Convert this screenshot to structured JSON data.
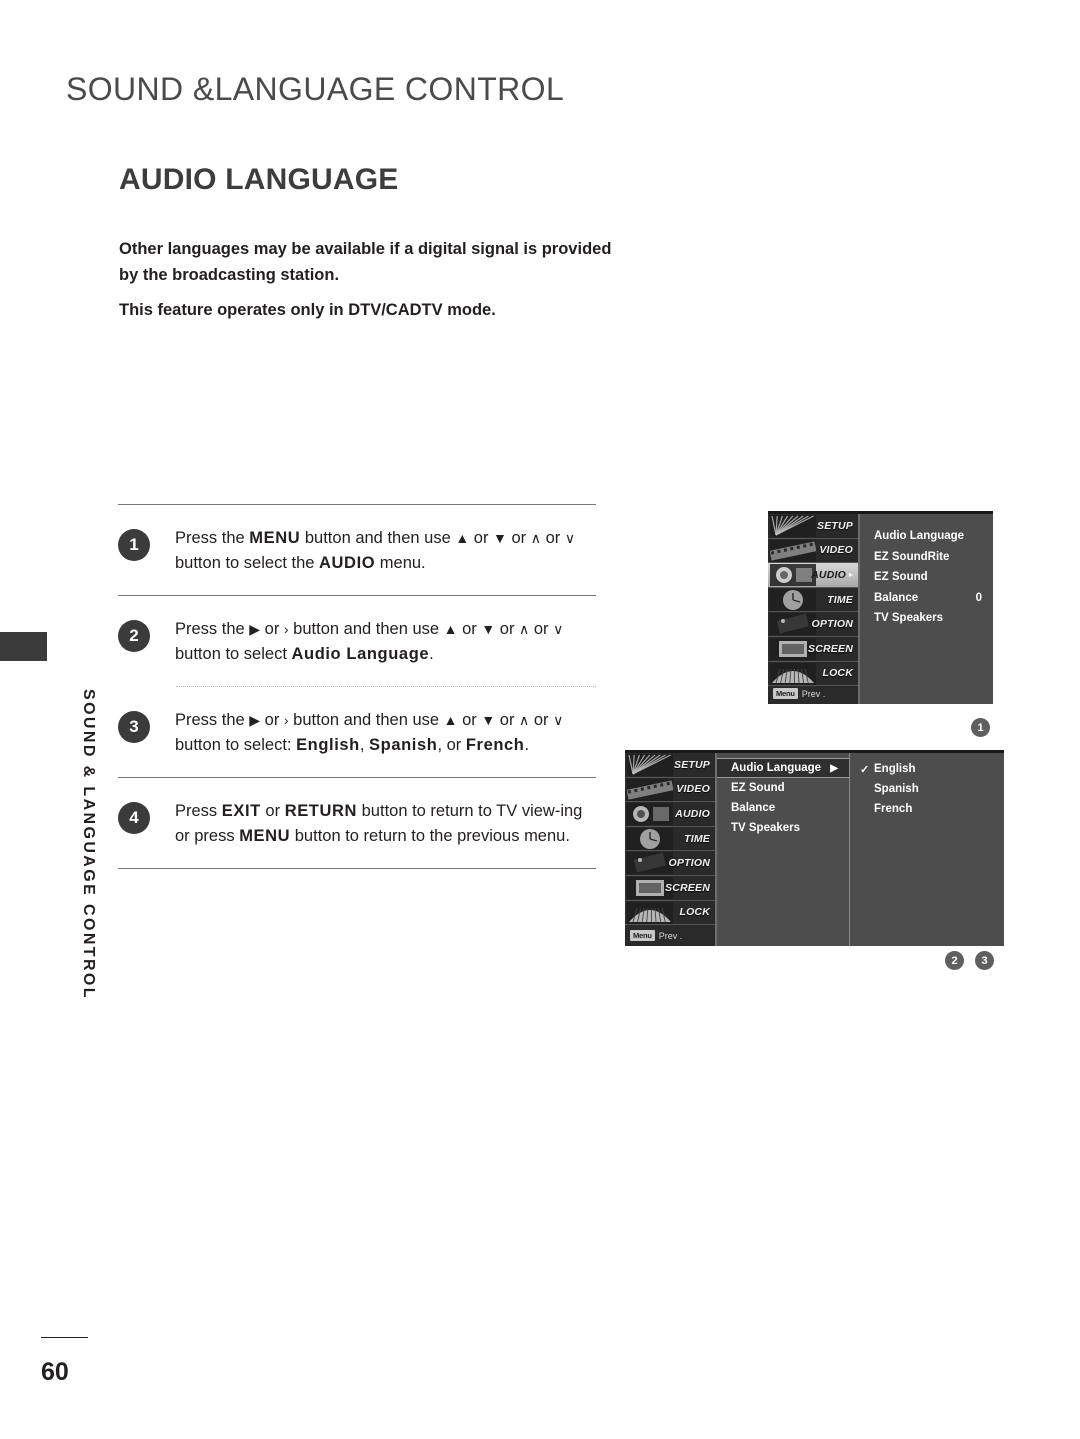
{
  "page": {
    "chapter_title": "SOUND &LANGUAGE CONTROL",
    "section_title": "AUDIO LANGUAGE",
    "page_number": "60",
    "side_tab_label": "SOUND & LANGUAGE CONTROL"
  },
  "intro": {
    "line1": "Other languages may be available if a digital signal is provided by the broadcasting station.",
    "line2": "This feature operates only in DTV/CADTV mode."
  },
  "steps": [
    {
      "number": "1",
      "parts": [
        {
          "t": "Press the ",
          "b": false
        },
        {
          "t": "MENU",
          "b": true
        },
        {
          "t": " button and then use ",
          "b": false
        },
        {
          "t": "▲",
          "b": false
        },
        {
          "t": " or ",
          "b": false
        },
        {
          "t": "▼",
          "b": false
        },
        {
          "t": "  or  ",
          "b": false
        },
        {
          "t": "∧",
          "b": false
        },
        {
          "t": " or ",
          "b": false
        },
        {
          "t": "∨",
          "b": false
        },
        {
          "t": "  button to select the ",
          "b": false
        },
        {
          "t": "AUDIO",
          "b": true
        },
        {
          "t": " menu.",
          "b": false
        }
      ]
    },
    {
      "number": "2",
      "parts": [
        {
          "t": "Press the ",
          "b": false
        },
        {
          "t": "▶",
          "b": false
        },
        {
          "t": " or ",
          "b": false
        },
        {
          "t": "›",
          "b": false
        },
        {
          "t": "  button and then use ",
          "b": false
        },
        {
          "t": "▲",
          "b": false
        },
        {
          "t": " or ",
          "b": false
        },
        {
          "t": "▼",
          "b": false
        },
        {
          "t": "  or  ",
          "b": false
        },
        {
          "t": "∧",
          "b": false
        },
        {
          "t": " or ",
          "b": false
        },
        {
          "t": "∨",
          "b": false
        },
        {
          "t": "  button to select ",
          "b": false
        },
        {
          "t": "Audio Language",
          "b": true
        },
        {
          "t": ".",
          "b": false
        }
      ]
    },
    {
      "number": "3",
      "parts": [
        {
          "t": "Press the ",
          "b": false
        },
        {
          "t": "▶",
          "b": false
        },
        {
          "t": " or ",
          "b": false
        },
        {
          "t": "›",
          "b": false
        },
        {
          "t": "  button and then use ",
          "b": false
        },
        {
          "t": "▲",
          "b": false
        },
        {
          "t": " or ",
          "b": false
        },
        {
          "t": "▼",
          "b": false
        },
        {
          "t": "  or  ",
          "b": false
        },
        {
          "t": "∧",
          "b": false
        },
        {
          "t": " or ",
          "b": false
        },
        {
          "t": "∨",
          "b": false
        },
        {
          "t": "  button to select: ",
          "b": false
        },
        {
          "t": "English",
          "b": true
        },
        {
          "t": ", ",
          "b": false
        },
        {
          "t": "Spanish",
          "b": true
        },
        {
          "t": ", or ",
          "b": false
        },
        {
          "t": "French",
          "b": true
        },
        {
          "t": ".",
          "b": false
        }
      ]
    },
    {
      "number": "4",
      "parts": [
        {
          "t": "Press ",
          "b": false
        },
        {
          "t": "EXIT",
          "b": true
        },
        {
          "t": " or ",
          "b": false
        },
        {
          "t": "RETURN",
          "b": true
        },
        {
          "t": " button to return to TV view-ing or press ",
          "b": false
        },
        {
          "t": "MENU",
          "b": true
        },
        {
          "t": " button to return to the previous menu.",
          "b": false
        }
      ]
    }
  ],
  "osd_screens": [
    {
      "marker": "1",
      "sidebar": [
        {
          "label": "SETUP",
          "icon": "fan-icon",
          "selected": false,
          "caret": ""
        },
        {
          "label": "VIDEO",
          "icon": "filmstrip-icon",
          "selected": false,
          "caret": ""
        },
        {
          "label": "AUDIO",
          "icon": "speaker-dial-icon",
          "selected": true,
          "caret": "▸"
        },
        {
          "label": "TIME",
          "icon": "clock-icon",
          "selected": false,
          "caret": ""
        },
        {
          "label": "OPTION",
          "icon": "tag-icon",
          "selected": false,
          "caret": ""
        },
        {
          "label": "SCREEN",
          "icon": "monitor-icon",
          "selected": false,
          "caret": ""
        },
        {
          "label": "LOCK",
          "icon": "lock-icon",
          "selected": false,
          "caret": ""
        }
      ],
      "prev_key": "Menu",
      "prev_label": "Prev .",
      "rows": [
        {
          "label": "Audio Language",
          "value": "",
          "selected": false,
          "arrow": ""
        },
        {
          "label": "EZ SoundRite",
          "value": "",
          "selected": false,
          "arrow": ""
        },
        {
          "label": "EZ Sound",
          "value": "",
          "selected": false,
          "arrow": ""
        },
        {
          "label": "Balance",
          "value": "0",
          "selected": false,
          "arrow": ""
        },
        {
          "label": "TV Speakers",
          "value": "",
          "selected": false,
          "arrow": ""
        }
      ],
      "submenu": []
    },
    {
      "markers": [
        "2",
        "3"
      ],
      "sidebar": [
        {
          "label": "SETUP",
          "icon": "fan-icon",
          "selected": false,
          "caret": ""
        },
        {
          "label": "VIDEO",
          "icon": "filmstrip-icon",
          "selected": false,
          "caret": ""
        },
        {
          "label": "AUDIO",
          "icon": "speaker-dial-icon",
          "selected": false,
          "caret": ""
        },
        {
          "label": "TIME",
          "icon": "clock-icon",
          "selected": false,
          "caret": ""
        },
        {
          "label": "OPTION",
          "icon": "tag-icon",
          "selected": false,
          "caret": ""
        },
        {
          "label": "SCREEN",
          "icon": "monitor-icon",
          "selected": false,
          "caret": ""
        },
        {
          "label": "LOCK",
          "icon": "lock-icon",
          "selected": false,
          "caret": ""
        }
      ],
      "prev_key": "Menu",
      "prev_label": "Prev .",
      "rows": [
        {
          "label": "Audio Language",
          "value": "",
          "selected": true,
          "arrow": "▶"
        },
        {
          "label": "EZ Sound",
          "value": "",
          "selected": false,
          "arrow": ""
        },
        {
          "label": "Balance",
          "value": "",
          "selected": false,
          "arrow": ""
        },
        {
          "label": "TV Speakers",
          "value": "",
          "selected": false,
          "arrow": ""
        }
      ],
      "submenu": [
        {
          "label": "English",
          "checked": "✓"
        },
        {
          "label": "Spanish",
          "checked": ""
        },
        {
          "label": "French",
          "checked": ""
        }
      ]
    }
  ],
  "colors": {
    "osd_panel": "#4d4d4d",
    "osd_sidebar": "#2a2a2a",
    "badge": "#3b3b3b",
    "marker": "#5f5f5f",
    "rule": "#77787b"
  }
}
